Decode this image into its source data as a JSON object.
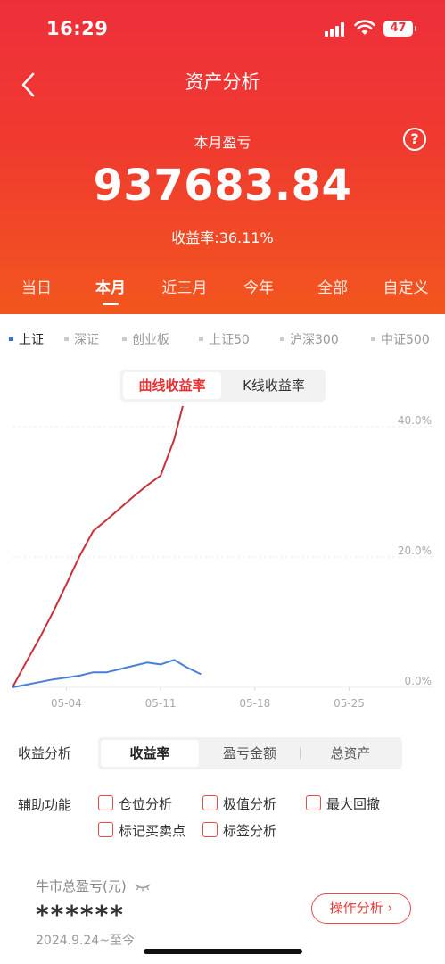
{
  "status": {
    "time": "16:29",
    "battery": "47"
  },
  "nav": {
    "title": "资产分析"
  },
  "summary": {
    "label": "本月盈亏",
    "amount": "937683.84",
    "rate": "收益率:36.11%"
  },
  "periods": [
    "当日",
    "本月",
    "近三月",
    "今年",
    "全部",
    "自定义"
  ],
  "active_period": "本月",
  "indices": [
    "上证",
    "深证",
    "创业板",
    "上证50",
    "沪深300",
    "中证500"
  ],
  "active_index": "上证",
  "chart_toggle": {
    "active": "曲线收益率",
    "inactive": "K线收益率"
  },
  "colors": {
    "accent": "#ee2f3a",
    "portfolio_line": "#c8323a",
    "index_line": "#4a7fd4"
  },
  "chart_data": {
    "type": "line",
    "x_ticks": [
      "05-04",
      "05-11",
      "05-18",
      "05-25"
    ],
    "y_ticks": [
      "40.0%",
      "20.0%",
      "0.0%"
    ],
    "ylim": [
      0,
      40
    ],
    "grid": true,
    "series": [
      {
        "color": "#c8323a",
        "x": [
          0,
          1,
          2,
          3,
          4,
          5,
          6,
          7,
          8,
          9,
          10,
          11,
          12,
          13,
          14
        ],
        "values": [
          0,
          3.8,
          7.5,
          11.5,
          15.8,
          20.2,
          24.0,
          25.7,
          27.5,
          29.3,
          31.0,
          32.5,
          38.0,
          46.0,
          47.5
        ]
      },
      {
        "color": "#4a7fd4",
        "x": [
          0,
          1,
          2,
          3,
          4,
          5,
          6,
          7,
          8,
          9,
          10,
          11,
          12,
          13,
          14
        ],
        "values": [
          0,
          0.4,
          0.8,
          1.2,
          1.5,
          1.8,
          2.3,
          2.3,
          2.8,
          3.3,
          3.8,
          3.5,
          4.2,
          3.0,
          2.0
        ]
      }
    ]
  },
  "analysis": {
    "label": "收益分析",
    "tabs": [
      "收益率",
      "盈亏金额",
      "总资产"
    ],
    "active": "收益率"
  },
  "aux": {
    "label": "辅助功能",
    "options": [
      "仓位分析",
      "极值分析",
      "最大回撤",
      "标记买卖点",
      "标签分析"
    ]
  },
  "bull": {
    "title": "牛市总盈亏(元)",
    "value": "******",
    "since": "2024.9.24~至今",
    "button": "操作分析 ›"
  }
}
